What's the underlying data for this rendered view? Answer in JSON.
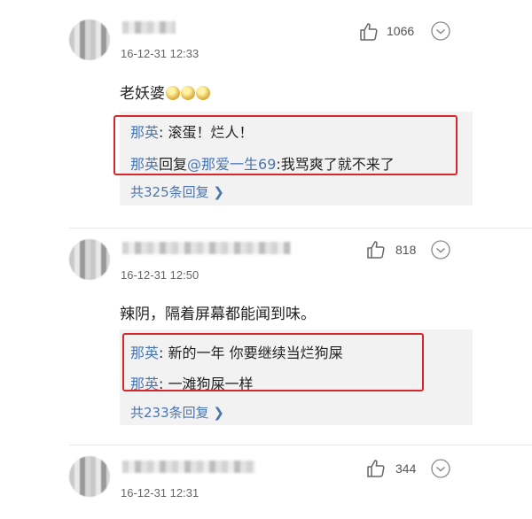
{
  "comments": [
    {
      "time": "16-12-31 12:33",
      "likes": "1066",
      "text": "老妖婆",
      "emoji_count": 3,
      "replies": [
        {
          "name": "那英",
          "sep": ": ",
          "body": "滚蛋！烂人！"
        },
        {
          "name": "那英",
          "mid": "回复",
          "mention": "@那爱一生69",
          "body": ":我骂爽了就不来了"
        }
      ],
      "total_replies": "共325条回复 ❯"
    },
    {
      "time": "16-12-31 12:50",
      "likes": "818",
      "text": "辣阴，隔着屏幕都能闻到味。",
      "replies": [
        {
          "name": "那英",
          "sep": ": ",
          "body": "新的一年 你要继续当烂狗屎"
        },
        {
          "name": "那英",
          "sep": ": ",
          "body": "一滩狗屎一样"
        }
      ],
      "total_replies": "共233条回复 ❯"
    },
    {
      "time": "16-12-31 12:31",
      "likes": "344"
    }
  ],
  "icons": {
    "like": "thumbs-up-icon",
    "more": "more-menu-icon"
  },
  "colors": {
    "link": "#4a76b0",
    "highlight_frame": "#d9262b",
    "reply_bg": "#f2f2f2"
  }
}
